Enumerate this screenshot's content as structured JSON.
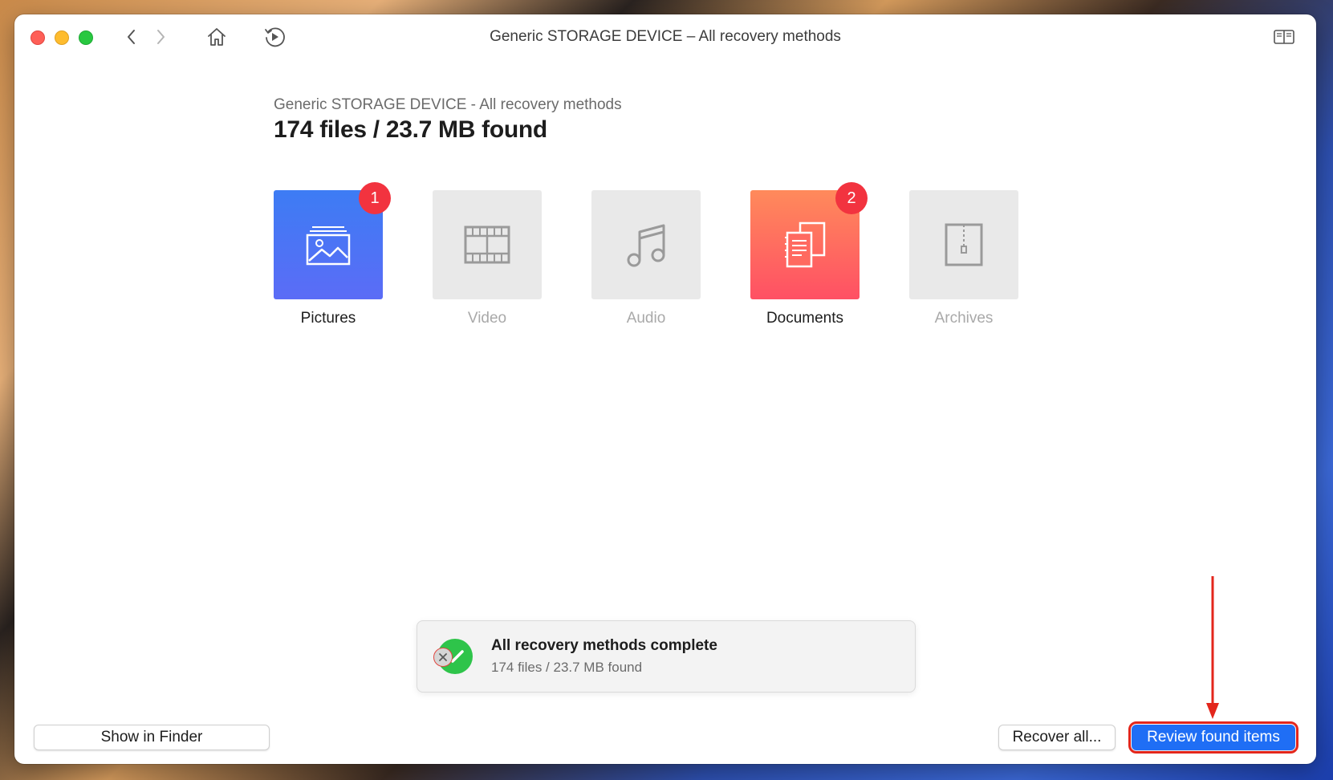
{
  "window": {
    "title": "Generic STORAGE DEVICE – All recovery methods"
  },
  "toolbar": {
    "back_icon": "chevron-left-icon",
    "forward_icon": "chevron-right-icon",
    "home_icon": "home-icon",
    "history_icon": "history-play-icon",
    "sidebar_icon": "sidebar-toggle-icon"
  },
  "summary": {
    "subtitle": "Generic STORAGE DEVICE - All recovery methods",
    "headline": "174 files / 23.7 MB found"
  },
  "categories": [
    {
      "label": "Pictures",
      "badge": "1",
      "enabled": true,
      "icon": "picture-icon"
    },
    {
      "label": "Video",
      "badge": "",
      "enabled": false,
      "icon": "film-icon"
    },
    {
      "label": "Audio",
      "badge": "",
      "enabled": false,
      "icon": "music-note-icon"
    },
    {
      "label": "Documents",
      "badge": "2",
      "enabled": true,
      "icon": "documents-icon"
    },
    {
      "label": "Archives",
      "badge": "",
      "enabled": false,
      "icon": "archive-zip-icon"
    }
  ],
  "toast": {
    "title": "All recovery methods complete",
    "subtitle": "174 files / 23.7 MB found"
  },
  "buttons": {
    "show_in_finder": "Show in Finder",
    "recover_all": "Recover all...",
    "review_found_items": "Review found items"
  },
  "colors": {
    "accent_blue": "#1f6ef5",
    "badge_red": "#f2333f",
    "success_green": "#2ec44a",
    "highlight_red": "#e3261c"
  }
}
